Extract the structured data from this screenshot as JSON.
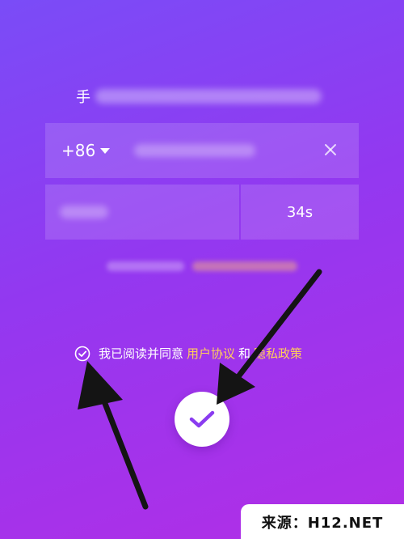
{
  "header": {
    "title_prefix": "手"
  },
  "phone": {
    "country_code": "+86",
    "clear_icon": "close-icon"
  },
  "code": {
    "timer": "34s"
  },
  "agreement": {
    "checkbox_icon": "check-circle-icon",
    "text": "我已阅读并同意",
    "user_agreement": "用户协议",
    "and": "和",
    "privacy_policy": "隐私政策"
  },
  "submit": {
    "icon": "check-icon",
    "color": "#8a3cf0"
  },
  "watermark": {
    "text": "来源：H12.NET"
  },
  "colors": {
    "background_top": "#7a4cf7",
    "background_bottom": "#b22ee6",
    "link": "#ffce5a"
  }
}
